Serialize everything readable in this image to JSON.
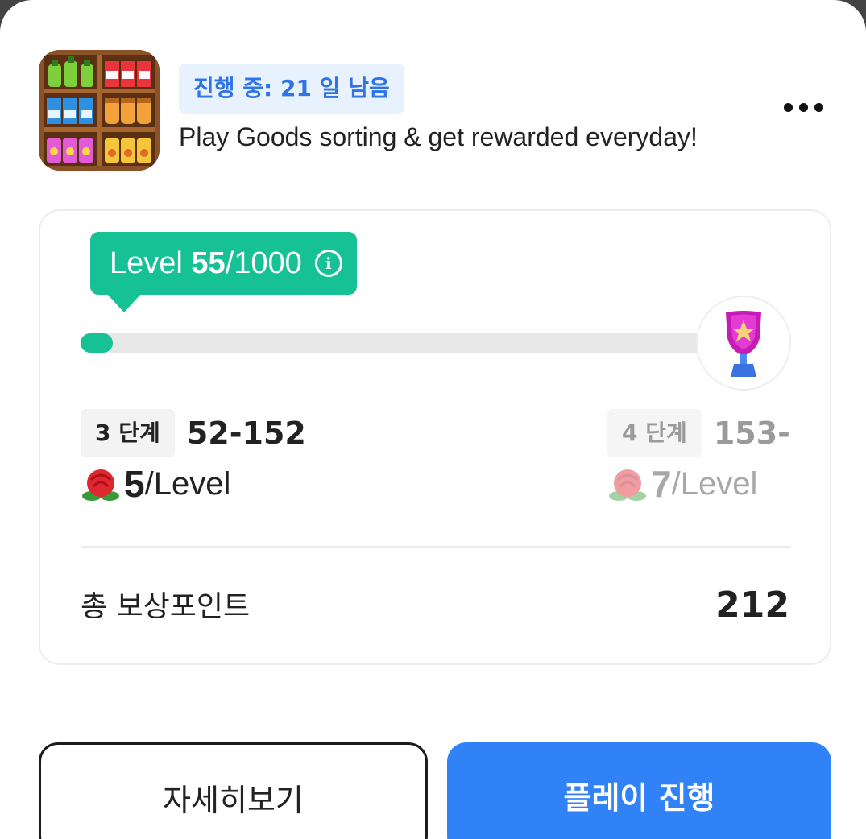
{
  "header": {
    "app_icon": "goods-shelf-game-icon",
    "status_badge": "진행 중: 21 일 남음",
    "subtitle": "Play Goods sorting & get rewarded everyday!",
    "more_icon": "more-dots-icon"
  },
  "progress": {
    "level_prefix": "Level ",
    "level_current": "55",
    "level_total": "/1000",
    "fill_fraction": 0.05,
    "goal_icon": "trophy-icon"
  },
  "tiers": {
    "current": {
      "chip": "3 단계",
      "range": "52-152",
      "rate_value": "5",
      "rate_unit": "/Level"
    },
    "next": {
      "chip": "4 단계",
      "range": "153-",
      "rate_value": "7",
      "rate_unit": "/Level"
    }
  },
  "total": {
    "label": "총 보상포인트",
    "value": "212"
  },
  "buttons": {
    "detail": "자세히보기",
    "play": "플레이 진행"
  },
  "colors": {
    "accent_green": "#16c195",
    "primary_blue": "#3182f6",
    "badge_text": "#2f73e8"
  }
}
